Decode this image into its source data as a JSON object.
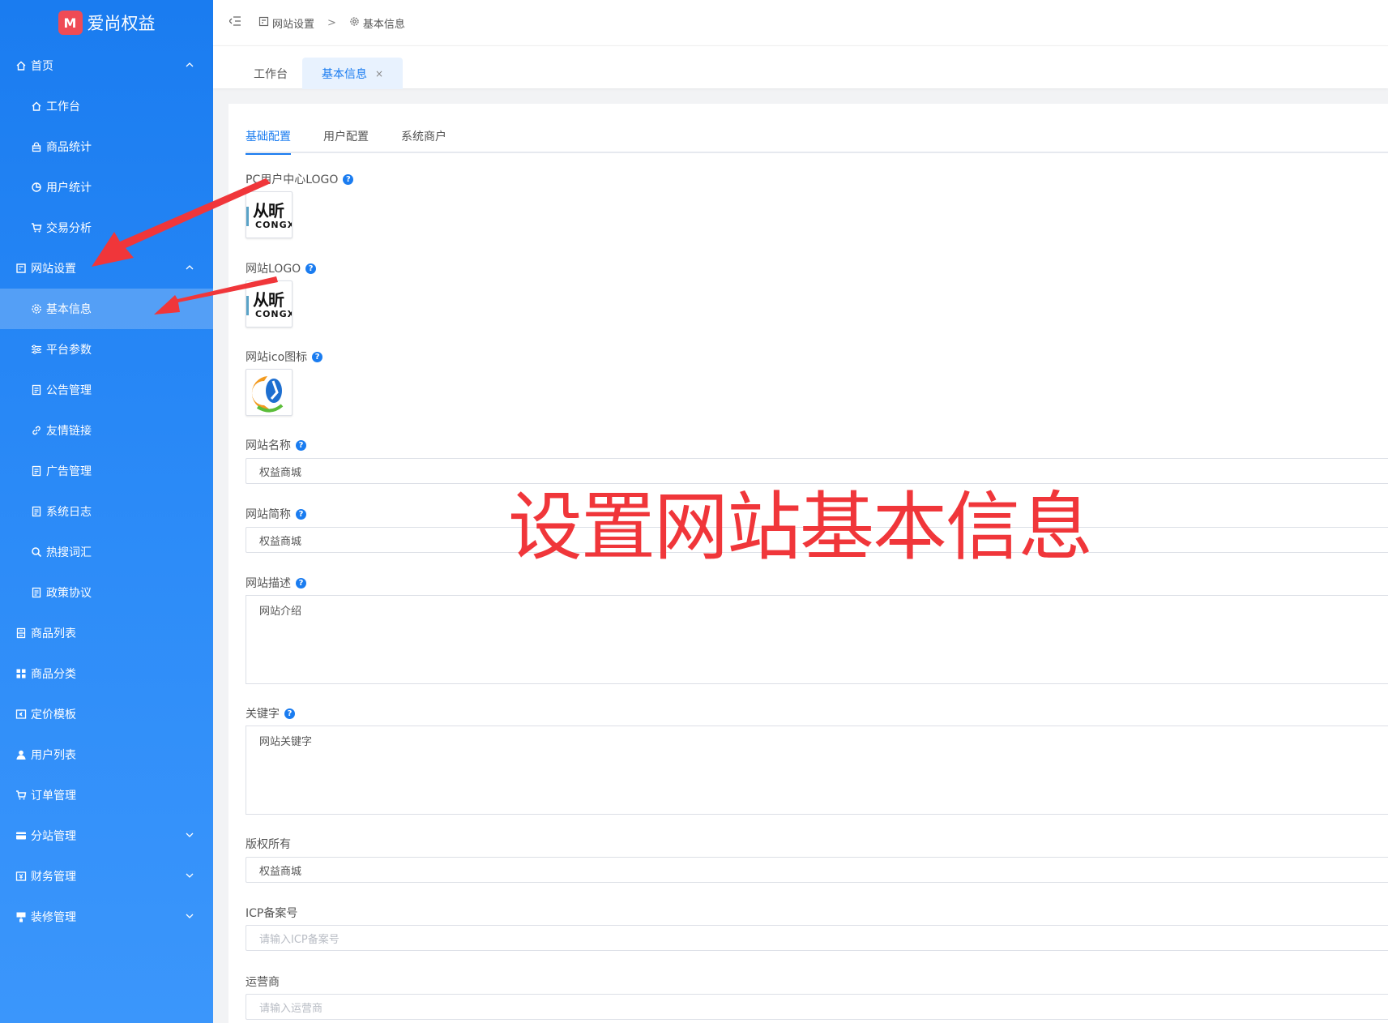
{
  "app": {
    "logo_mark": "M",
    "title": "爱尚权益"
  },
  "sidebar": {
    "items": [
      {
        "label": "首页",
        "icon": "home-icon",
        "level": 1,
        "caret": "up"
      },
      {
        "label": "工作台",
        "icon": "home-icon",
        "level": 2
      },
      {
        "label": "商品统计",
        "icon": "lock-icon",
        "level": 2
      },
      {
        "label": "用户统计",
        "icon": "pie-chart-icon",
        "level": 2
      },
      {
        "label": "交易分析",
        "icon": "cart-icon",
        "level": 2
      },
      {
        "label": "网站设置",
        "icon": "building-icon",
        "level": 1,
        "caret": "up"
      },
      {
        "label": "基本信息",
        "icon": "gear-icon",
        "level": 2,
        "active": true
      },
      {
        "label": "平台参数",
        "icon": "sliders-icon",
        "level": 2
      },
      {
        "label": "公告管理",
        "icon": "document-icon",
        "level": 2
      },
      {
        "label": "友情链接",
        "icon": "link-icon",
        "level": 2
      },
      {
        "label": "广告管理",
        "icon": "document-icon",
        "level": 2
      },
      {
        "label": "系统日志",
        "icon": "document-icon",
        "level": 2
      },
      {
        "label": "热搜词汇",
        "icon": "search-icon",
        "level": 2
      },
      {
        "label": "政策协议",
        "icon": "document-icon",
        "level": 2
      },
      {
        "label": "商品列表",
        "icon": "list-icon",
        "level": 1
      },
      {
        "label": "商品分类",
        "icon": "grid-icon",
        "level": 1
      },
      {
        "label": "定价模板",
        "icon": "price-icon",
        "level": 1
      },
      {
        "label": "用户列表",
        "icon": "user-icon",
        "level": 1
      },
      {
        "label": "订单管理",
        "icon": "cart-icon",
        "level": 1
      },
      {
        "label": "分站管理",
        "icon": "card-icon",
        "level": 1,
        "caret": "down"
      },
      {
        "label": "财务管理",
        "icon": "finance-icon",
        "level": 1,
        "caret": "down"
      },
      {
        "label": "装修管理",
        "icon": "paint-icon",
        "level": 1,
        "caret": "down"
      }
    ]
  },
  "header": {
    "breadcrumb": {
      "parent": "网站设置",
      "separator": ">",
      "current": "基本信息"
    }
  },
  "page_tabs": {
    "workbench": "工作台",
    "active": "基本信息",
    "close": "×"
  },
  "form": {
    "subtabs": [
      "基础配置",
      "用户配置",
      "系统商户"
    ],
    "pc_logo": {
      "label": "PC用户中心LOGO",
      "brand_cn": "从昕",
      "brand_en": "CONGX"
    },
    "site_logo": {
      "label": "网站LOGO",
      "brand_cn": "从昕",
      "brand_en": "CONGX"
    },
    "site_ico": {
      "label": "网站ico图标"
    },
    "site_name": {
      "label": "网站名称",
      "value": "权益商城"
    },
    "site_short": {
      "label": "网站简称",
      "value": "权益商城"
    },
    "site_desc": {
      "label": "网站描述",
      "value": "网站介绍"
    },
    "keywords": {
      "label": "关键字",
      "value": "网站关键字"
    },
    "copyright": {
      "label": "版权所有",
      "value": "权益商城"
    },
    "icp": {
      "label": "ICP备案号",
      "placeholder": "请输入ICP备案号"
    },
    "operator": {
      "label": "运营商",
      "placeholder": "请输入运营商"
    },
    "help_glyph": "?"
  },
  "annotation": {
    "text": "设置网站基本信息",
    "color": "#f0363a"
  },
  "colors": {
    "accent": "#1a7cf0",
    "sidebar_top": "#1a7cf0",
    "sidebar_bottom": "#3b96fb"
  }
}
